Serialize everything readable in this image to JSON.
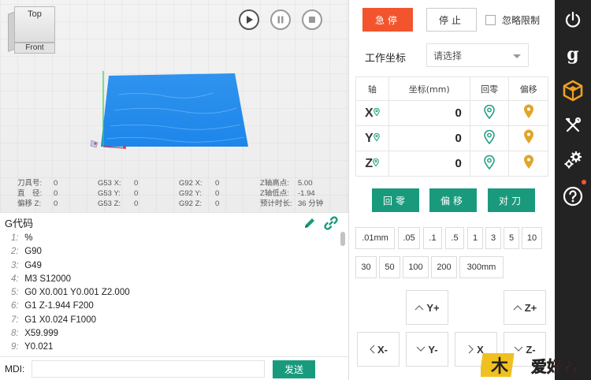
{
  "viewport": {
    "viewcube": {
      "top_label": "Top",
      "front_label": "Front"
    },
    "status": {
      "col1": [
        {
          "k": "刀具号:",
          "v": "0"
        },
        {
          "k": "直　径:",
          "v": "0"
        },
        {
          "k": "偏移 Z:",
          "v": "0"
        }
      ],
      "col2": [
        {
          "k": "G53  X:",
          "v": "0"
        },
        {
          "k": "G53  Y:",
          "v": "0"
        },
        {
          "k": "G53  Z:",
          "v": "0"
        }
      ],
      "col3": [
        {
          "k": "G92  X:",
          "v": "0"
        },
        {
          "k": "G92  Y:",
          "v": "0"
        },
        {
          "k": "G92  Z:",
          "v": "0"
        }
      ],
      "col4": [
        {
          "k": "Z轴高点:",
          "v": "5.00"
        },
        {
          "k": "Z轴低点:",
          "v": "-1.94"
        },
        {
          "k": "预计时长:",
          "v": "36 分钟"
        }
      ]
    }
  },
  "gcode": {
    "title": "G代码",
    "lines": [
      {
        "n": "1:",
        "code": "%"
      },
      {
        "n": "2:",
        "code": "G90"
      },
      {
        "n": "3:",
        "code": "G49"
      },
      {
        "n": "4:",
        "code": "M3 S12000"
      },
      {
        "n": "5:",
        "code": "G0 X0.001 Y0.001 Z2.000"
      },
      {
        "n": "6:",
        "code": "G1 Z-1.944 F200"
      },
      {
        "n": "7:",
        "code": "G1 X0.024 F1000"
      },
      {
        "n": "8:",
        "code": "X59.999"
      },
      {
        "n": "9:",
        "code": "Y0.021"
      }
    ]
  },
  "mdi": {
    "label": "MDI:",
    "value": "",
    "send_label": "发送"
  },
  "controls": {
    "estop_label": "急停",
    "stop_label": "停止",
    "ignore_limits_label": "忽略限制",
    "work_coord_label": "工作坐标",
    "work_coord_placeholder": "请选择",
    "table_headers": {
      "axis": "轴",
      "coord": "坐标(mm)",
      "home": "回零",
      "offset": "偏移"
    },
    "axes": [
      {
        "name": "X",
        "value": "0"
      },
      {
        "name": "Y",
        "value": "0"
      },
      {
        "name": "Z",
        "value": "0"
      }
    ],
    "home_label": "回零",
    "offset_label": "偏移",
    "probe_label": "对刀",
    "steps_row1": [
      ".01mm",
      ".05",
      ".1",
      ".5",
      "1",
      "3",
      "5",
      "10"
    ],
    "steps_row2": [
      "30",
      "50",
      "100",
      "200",
      "300mm"
    ],
    "jog": {
      "y_plus": "Y+",
      "z_plus": "Z+",
      "x_minus": "X-",
      "y_minus": "Y-",
      "x_plus": "X",
      "z_minus": "Z-"
    }
  },
  "colors": {
    "accent_green": "#1a9a7c",
    "estop_red": "#f2552d",
    "pin_teal": "#1a9a7c",
    "pin_gold": "#e0a52a",
    "sidebar_active": "#f0a020",
    "plane_blue": "#2f93ee"
  },
  "watermark": {
    "text": "爱好者"
  }
}
